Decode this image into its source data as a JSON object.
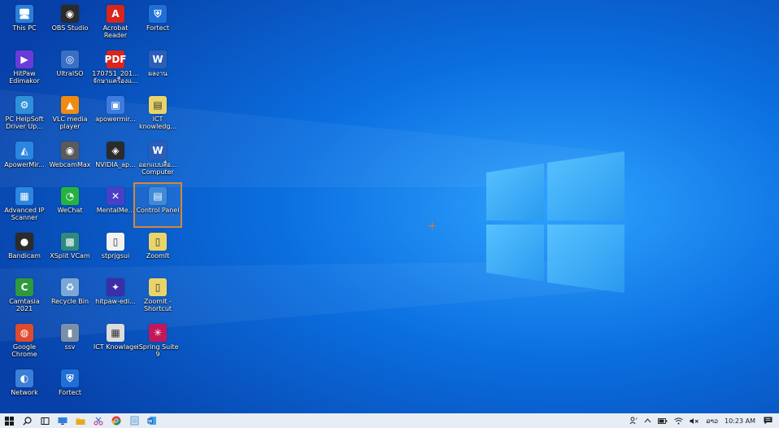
{
  "desktop": {
    "icons": [
      {
        "label": "This PC",
        "glyph": "🖥",
        "color": "#2a7fd6"
      },
      {
        "label": "OBS Studio",
        "glyph": "◉",
        "color": "#2b2b2b"
      },
      {
        "label": "Acrobat Reader",
        "glyph": "A",
        "color": "#d9251c"
      },
      {
        "label": "Fortect",
        "glyph": "⛨",
        "color": "#1f6fd8"
      },
      {
        "label": "HitPaw Edimakor",
        "glyph": "▶",
        "color": "#6a3bd8"
      },
      {
        "label": "UltraISO",
        "glyph": "◎",
        "color": "#3a6fc6"
      },
      {
        "label": "170751_201... จักษาแครื่องแ...",
        "glyph": "PDF",
        "color": "#d9251c"
      },
      {
        "label": "ผลงาน",
        "glyph": "W",
        "color": "#2b5eb8"
      },
      {
        "label": "PC HelpSoft Driver Up...",
        "glyph": "⚙",
        "color": "#2f8fd8"
      },
      {
        "label": "VLC media player",
        "glyph": "▲",
        "color": "#f08a12"
      },
      {
        "label": "apowermir...",
        "glyph": "▣",
        "color": "#3c7be0"
      },
      {
        "label": "ICT knowledg...",
        "glyph": "▤",
        "color": "#e9d46a"
      },
      {
        "label": "ApowerMir...",
        "glyph": "◭",
        "color": "#2a86e0"
      },
      {
        "label": "WebcamMax",
        "glyph": "◉",
        "color": "#5a5a5a"
      },
      {
        "label": "NVIDIA_ap...",
        "glyph": "◈",
        "color": "#2b2b2b"
      },
      {
        "label": "ออกแบบสื่อ... Computer",
        "glyph": "W",
        "color": "#2b5eb8"
      },
      {
        "label": "Advanced IP Scanner",
        "glyph": "▦",
        "color": "#2a86e0"
      },
      {
        "label": "WeChat",
        "glyph": "◔",
        "color": "#25b33f"
      },
      {
        "label": "MentalMe...",
        "glyph": "✕",
        "color": "#4a3fc7"
      },
      {
        "label": "Control Panel",
        "glyph": "▤",
        "color": "#3f8ad8"
      },
      {
        "label": "Bandicam",
        "glyph": "●",
        "color": "#2b2b2b"
      },
      {
        "label": "XSplit VCam",
        "glyph": "▩",
        "color": "#2e8a80"
      },
      {
        "label": "stprjgsui",
        "glyph": "▯",
        "color": "#f2f2f2"
      },
      {
        "label": "ZoomIt",
        "glyph": "▯",
        "color": "#e9d46a"
      },
      {
        "label": "Camtasia 2021",
        "glyph": "C",
        "color": "#2e9a3e"
      },
      {
        "label": "Recycle Bin",
        "glyph": "♻",
        "color": "#7aa7d6"
      },
      {
        "label": "hitpaw-edi...",
        "glyph": "✦",
        "color": "#3a2fa8"
      },
      {
        "label": "ZoomIt - Shortcut",
        "glyph": "▯",
        "color": "#e9d46a"
      },
      {
        "label": "Google Chrome",
        "glyph": "◍",
        "color": "#e04a2f"
      },
      {
        "label": "ssv",
        "glyph": "▮",
        "color": "#7a8fa8"
      },
      {
        "label": "ICT Knowlage",
        "glyph": "▦",
        "color": "#dcdcdc"
      },
      {
        "label": "iSpring Suite 9",
        "glyph": "✳",
        "color": "#c2185b"
      },
      {
        "label": "Network",
        "glyph": "◐",
        "color": "#3b7fd8"
      },
      {
        "label": "Fortect",
        "glyph": "⛨",
        "color": "#1f6fd8"
      }
    ],
    "selected_index": 19
  },
  "taskbar": {
    "buttons": [
      {
        "name": "start-button",
        "icon": "windows-logo-icon"
      },
      {
        "name": "search-button",
        "icon": "search-icon"
      },
      {
        "name": "task-view-button",
        "icon": "task-view-icon"
      },
      {
        "name": "taskbar-app-desktop",
        "icon": "monitor-icon"
      },
      {
        "name": "taskbar-app-file-explorer",
        "icon": "folder-icon"
      },
      {
        "name": "taskbar-app-snip",
        "icon": "snip-icon"
      },
      {
        "name": "taskbar-app-chrome",
        "icon": "chrome-icon"
      },
      {
        "name": "taskbar-app-notepad",
        "icon": "notepad-icon"
      },
      {
        "name": "taskbar-app-word",
        "icon": "word-icon"
      }
    ],
    "tray": {
      "language": "ລາວ",
      "time": "10:23 AM"
    }
  },
  "colors": {
    "accent_selection": "#d4873a",
    "taskbar_bg": "#e6edf5"
  }
}
